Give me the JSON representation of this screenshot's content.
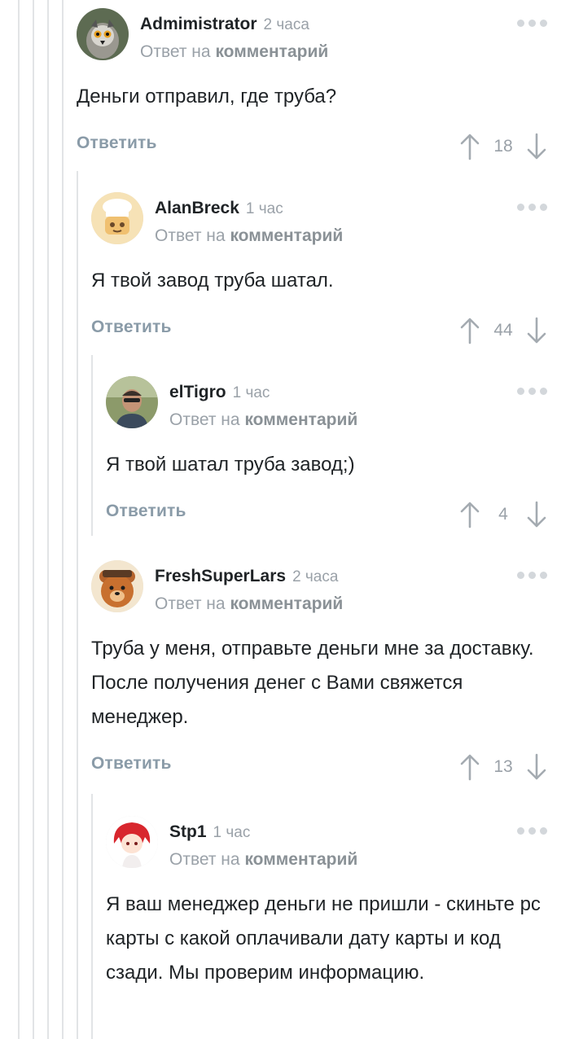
{
  "labels": {
    "reply_prefix": "Ответ на",
    "reply_link": "комментарий",
    "reply_button": "Ответить"
  },
  "comments": [
    {
      "author": "Admimistrator",
      "time": "2 часа",
      "text": "Деньги отправил, где труба?",
      "score": "18",
      "avatar_icon": "lemur-avatar-icon"
    },
    {
      "author": "AlanBreck",
      "time": "1 час",
      "text": "Я твой завод труба шатал.",
      "score": "44",
      "avatar_icon": "chef-avatar-icon"
    },
    {
      "author": "elTigro",
      "time": "1 час",
      "text": "Я твой шатал труба завод;)",
      "score": "4",
      "avatar_icon": "man-photo-avatar-icon"
    },
    {
      "author": "FreshSuperLars",
      "time": "2 часа",
      "text": "Труба у меня, отправьте деньги мне за доставку. После получения денег с Вами свяжется менеджер.",
      "score": "13",
      "avatar_icon": "bear-avatar-icon"
    },
    {
      "author": "Stp1",
      "time": "1 час",
      "text": "Я ваш менеджер деньги не пришли - скиньте pc карты с какой оплачивали дату карты и код сзади. Мы проверим информацию.",
      "score": "",
      "avatar_icon": "anime-girl-avatar-icon"
    }
  ],
  "colors": {
    "accent_link": "#8a9ba8",
    "muted": "#9aa1a8",
    "thread_line": "#e2e4e6"
  }
}
